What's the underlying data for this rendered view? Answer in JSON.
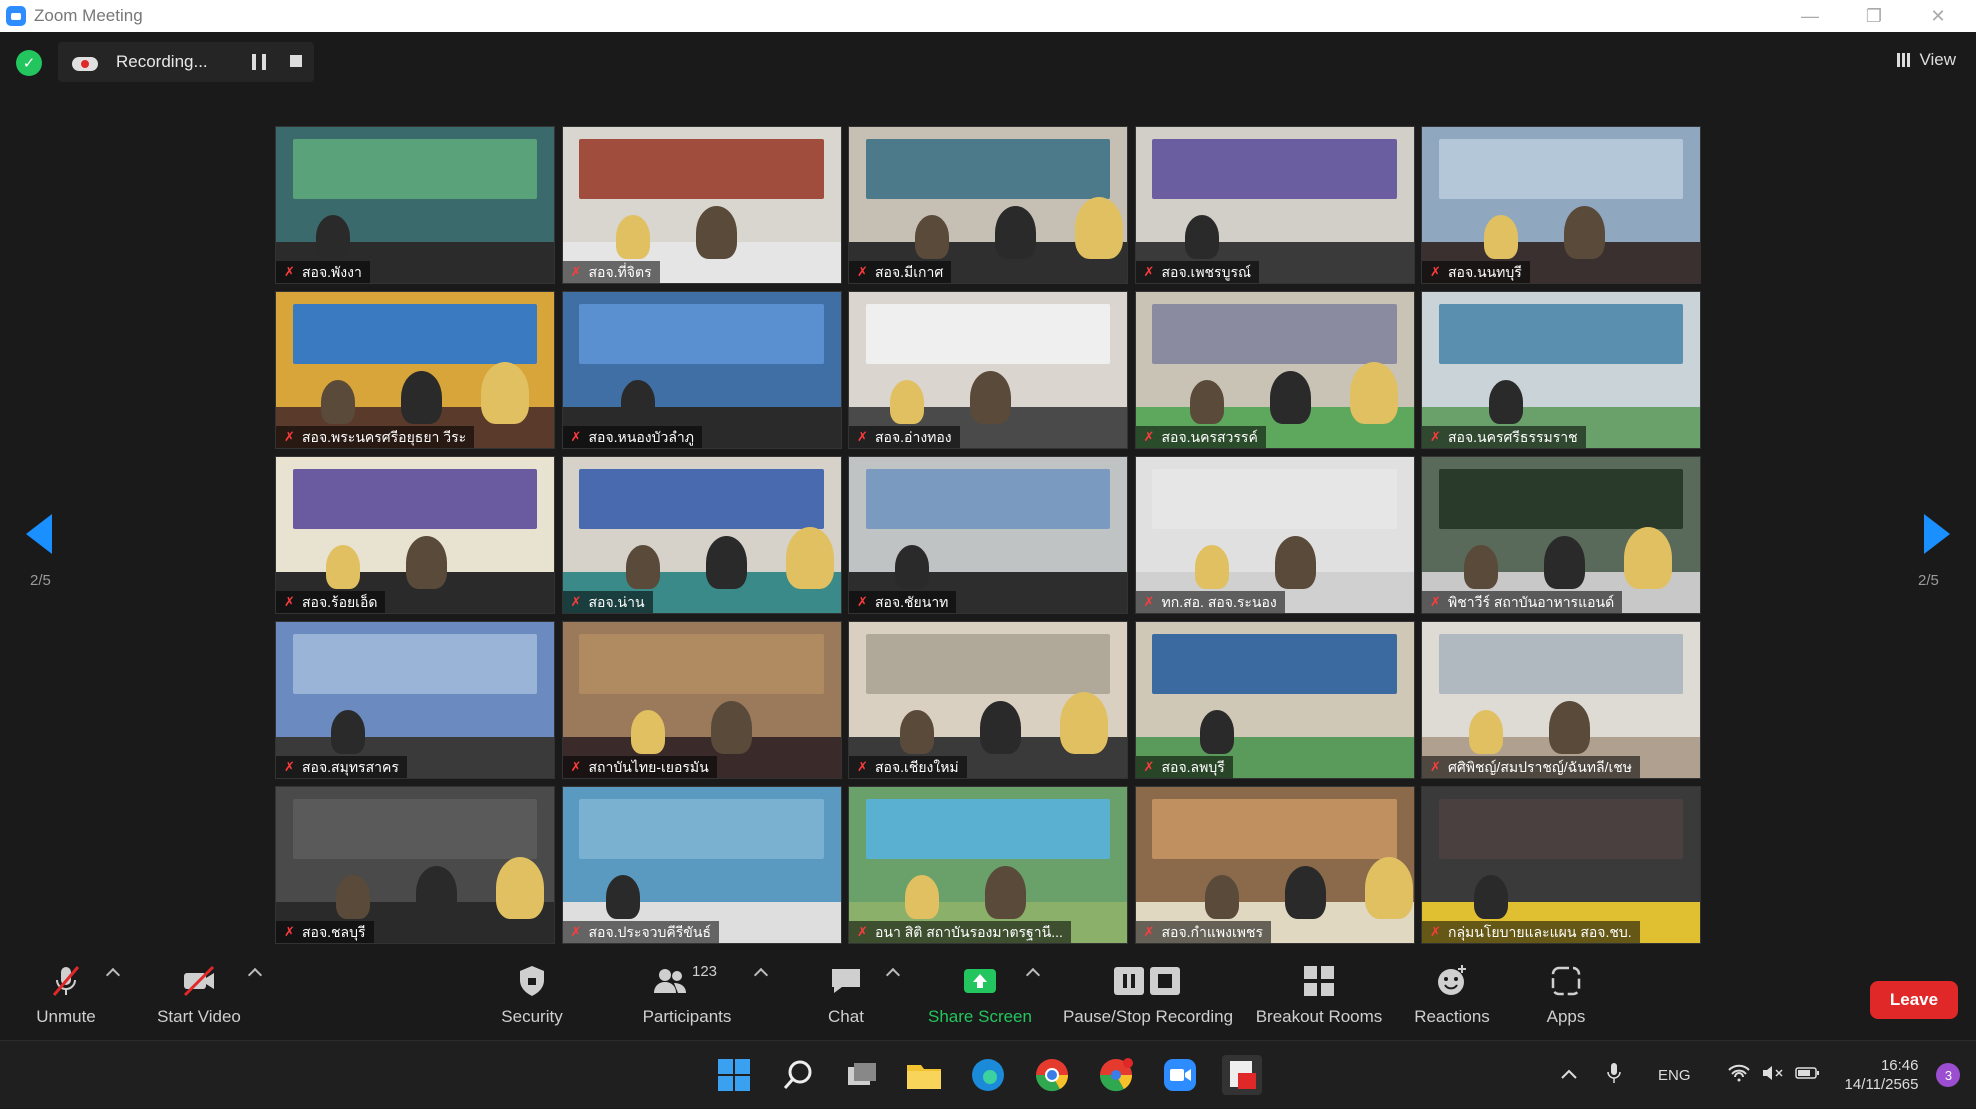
{
  "window": {
    "title": "Zoom Meeting"
  },
  "recording": {
    "label": "Recording..."
  },
  "view": {
    "label": "View"
  },
  "gallery": {
    "page_left": "2/5",
    "page_right": "2/5",
    "participants": [
      {
        "name": "สอจ.พังงา",
        "bg": "#3b6a6c",
        "banner": "#5aa37a",
        "desk": "#2b2b2b"
      },
      {
        "name": "สอจ.ที่จิตร",
        "bg": "#d9d5cf",
        "banner": "#a14d3d",
        "desk": "#e5e5e5"
      },
      {
        "name": "สอจ.มีเกาศ",
        "bg": "#c6c0b4",
        "banner": "#4d7a8a",
        "desk": "#2f2f2f"
      },
      {
        "name": "สอจ.เพชรบูรณ์",
        "bg": "#d2cfc9",
        "banner": "#6b5ea0",
        "desk": "#3a3a3a"
      },
      {
        "name": "สอจ.นนทบุรี",
        "bg": "#8fa8bf",
        "banner": "#b3c7d8",
        "desk": "#3a3030"
      },
      {
        "name": "สอจ.พระนครศรีอยุธยา วีระ",
        "bg": "#d7a53a",
        "banner": "#3a7ac0",
        "desk": "#5a3a2a"
      },
      {
        "name": "สอจ.หนองบัวลำภู",
        "bg": "#3f6fa5",
        "banner": "#5a8fd0",
        "desk": "#2a2a2a"
      },
      {
        "name": "สอจ.อ่างทอง",
        "bg": "#dad6cf",
        "banner": "#efefef",
        "desk": "#4a4a4a"
      },
      {
        "name": "สอจ.นครสวรรค์",
        "bg": "#c9c3b6",
        "banner": "#8a8aa0",
        "desk": "#5ea85e"
      },
      {
        "name": "สอจ.นครศรีธรรมราช",
        "bg": "#c9d3d8",
        "banner": "#5a8fb0",
        "desk": "#6aa06a"
      },
      {
        "name": "สอจ.ร้อยเอ็ด",
        "bg": "#e8e2d0",
        "banner": "#6a5aa0",
        "desk": "#2a2a2a"
      },
      {
        "name": "สอจ.น่าน",
        "bg": "#d6d2ca",
        "banner": "#4a6ab0",
        "desk": "#3a8a8a"
      },
      {
        "name": "สอจ.ชัยนาท",
        "bg": "#bfc3c4",
        "banner": "#7a9ac0",
        "desk": "#2d2d2d"
      },
      {
        "name": "ทก.สอ. สอจ.ระนอง",
        "bg": "#e0e0e0",
        "banner": "#e6e6e6",
        "desk": "#d0d0d0"
      },
      {
        "name": "พิชาวีร์ สถาบันอาหารแอนด์",
        "bg": "#5a6a5a",
        "banner": "#2a3a2a",
        "desk": "#c8c8c8"
      },
      {
        "name": "สอจ.สมุทรสาคร",
        "bg": "#6a8ac0",
        "banner": "#9ab4d8",
        "desk": "#3a3a3a"
      },
      {
        "name": "สถาบันไทย-เยอรมัน",
        "bg": "#9a7a5a",
        "banner": "#b08a60",
        "desk": "#3a2a2a"
      },
      {
        "name": "สอจ.เชียงใหม่",
        "bg": "#d9d0c2",
        "banner": "#b0a898",
        "desk": "#3a3a3a"
      },
      {
        "name": "สอจ.ลพบุรี",
        "bg": "#d0c8b6",
        "banner": "#3a6aa0",
        "desk": "#5a9a5a"
      },
      {
        "name": "ศศิพิชญ์/สมปราชญ์/ฉันทลี/เชษ",
        "bg": "#dedad4",
        "banner": "#b0b8c0",
        "desk": "#b0a090"
      },
      {
        "name": "สอจ.ชลบุรี",
        "bg": "#4a4a4a",
        "banner": "#5a5a5a",
        "desk": "#2a2a2a"
      },
      {
        "name": "สอจ.ประจวบคีรีขันธ์",
        "bg": "#5a9ac0",
        "banner": "#7ab0d0",
        "desk": "#dedede"
      },
      {
        "name": "อนา สิติ สถาบันรองมาตรฐานี...",
        "bg": "#6aa06a",
        "banner": "#5ab0d0",
        "desk": "#8ab06a"
      },
      {
        "name": "สอจ.กำแพงเพชร",
        "bg": "#8a6a4a",
        "banner": "#c09060",
        "desk": "#e0d8c0"
      },
      {
        "name": "กลุ่มนโยบายและแผน สอจ.ชบ.",
        "bg": "#3a3a3a",
        "banner": "#4a4040",
        "desk": "#e0c030"
      }
    ]
  },
  "toolbar": {
    "unmute": "Unmute",
    "start_video": "Start Video",
    "security": "Security",
    "participants": "Participants",
    "participants_count": "123",
    "chat": "Chat",
    "share_screen": "Share Screen",
    "pause_stop": "Pause/Stop Recording",
    "breakout": "Breakout Rooms",
    "reactions": "Reactions",
    "apps": "Apps",
    "leave": "Leave"
  },
  "taskbar": {
    "lang": "ENG",
    "time": "16:46",
    "date": "14/11/2565",
    "badge": "3"
  },
  "colors": {
    "accent": "#1a8fff",
    "leave": "#e02828",
    "share": "#23c55e"
  }
}
